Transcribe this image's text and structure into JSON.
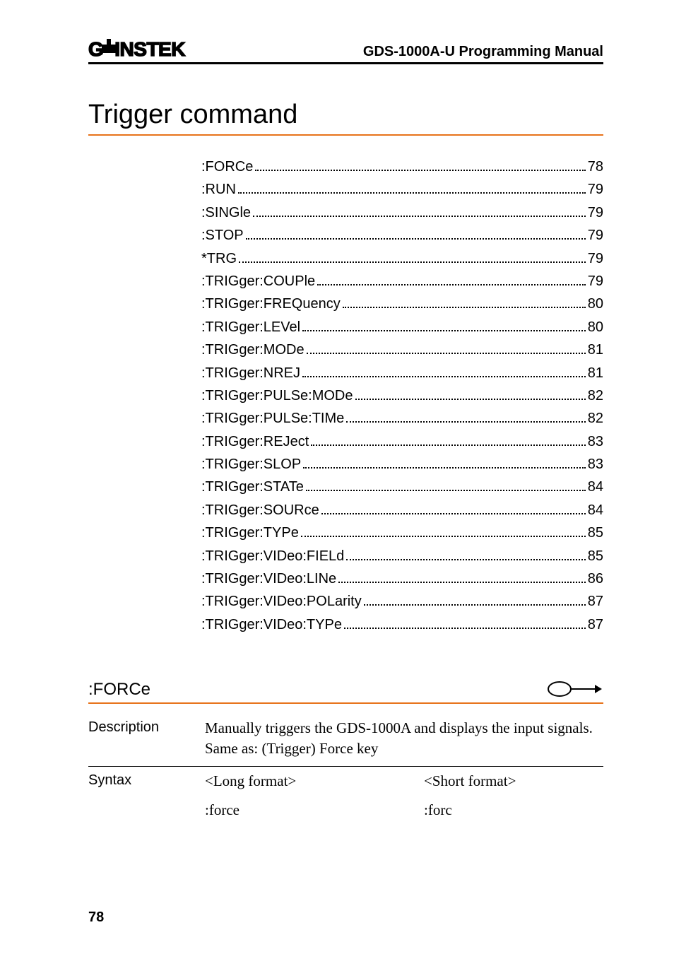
{
  "header": {
    "brand_prefix": "G",
    "brand_suffix": "INSTEK",
    "manual_title": "GDS-1000A-U Programming Manual"
  },
  "section_title": "Trigger command",
  "toc": [
    {
      "label": ":FORCe",
      "page": "78"
    },
    {
      "label": ":RUN",
      "page": "79"
    },
    {
      "label": ":SINGle",
      "page": "79"
    },
    {
      "label": ":STOP",
      "page": "79"
    },
    {
      "label": "*TRG",
      "page": "79"
    },
    {
      "label": ":TRIGger:COUPle",
      "page": "79"
    },
    {
      "label": ":TRIGger:FREQuency",
      "page": "80"
    },
    {
      "label": ":TRIGger:LEVel",
      "page": "80"
    },
    {
      "label": ":TRIGger:MODe",
      "page": "81"
    },
    {
      "label": ":TRIGger:NREJ",
      "page": "81"
    },
    {
      "label": ":TRIGger:PULSe:MODe",
      "page": "82"
    },
    {
      "label": ":TRIGger:PULSe:TIMe",
      "page": "82"
    },
    {
      "label": ":TRIGger:REJect",
      "page": "83"
    },
    {
      "label": ":TRIGger:SLOP",
      "page": "83"
    },
    {
      "label": ":TRIGger:STATe",
      "page": "84"
    },
    {
      "label": ":TRIGger:SOURce",
      "page": "84"
    },
    {
      "label": ":TRIGger:TYPe",
      "page": "85"
    },
    {
      "label": ":TRIGger:VIDeo:FIELd",
      "page": "85"
    },
    {
      "label": ":TRIGger:VIDeo:LINe",
      "page": "86"
    },
    {
      "label": ":TRIGger:VIDeo:POLarity",
      "page": "87"
    },
    {
      "label": ":TRIGger:VIDeo:TYPe",
      "page": "87"
    }
  ],
  "command": {
    "name": ":FORCe",
    "type_icon": "set-icon",
    "description_line1": "Manually triggers the GDS-1000A and displays the input signals.",
    "description_line2": "Same as: (Trigger) Force key",
    "syntax": {
      "long_header": "<Long format>",
      "short_header": "<Short format>",
      "long_value": ":force",
      "short_value": ":forc"
    },
    "labels": {
      "description": "Description",
      "syntax": "Syntax"
    }
  },
  "page_number": "78"
}
